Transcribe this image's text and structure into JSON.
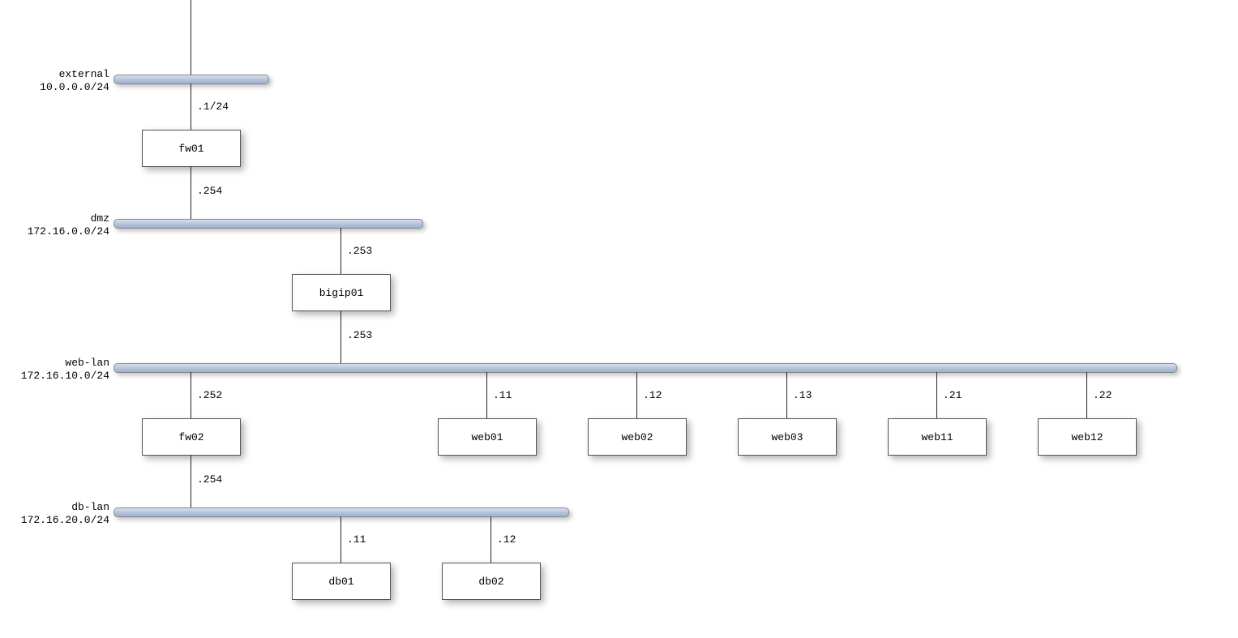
{
  "networks": {
    "external": {
      "name": "external",
      "cidr": "10.0.0.0/24"
    },
    "dmz": {
      "name": "dmz",
      "cidr": "172.16.0.0/24"
    },
    "weblan": {
      "name": "web-lan",
      "cidr": "172.16.10.0/24"
    },
    "dblan": {
      "name": "db-lan",
      "cidr": "172.16.20.0/24"
    }
  },
  "nodes": {
    "fw01": {
      "name": "fw01"
    },
    "bigip01": {
      "name": "bigip01"
    },
    "fw02": {
      "name": "fw02"
    },
    "web01": {
      "name": "web01"
    },
    "web02": {
      "name": "web02"
    },
    "web03": {
      "name": "web03"
    },
    "web11": {
      "name": "web11"
    },
    "web12": {
      "name": "web12"
    },
    "db01": {
      "name": "db01"
    },
    "db02": {
      "name": "db02"
    }
  },
  "interfaces": {
    "fw01_ext": ".1/24",
    "fw01_dmz": ".254",
    "bigip01_dmz": ".253",
    "bigip01_web": ".253",
    "fw02_web": ".252",
    "fw02_db": ".254",
    "web01": ".11",
    "web02": ".12",
    "web03": ".13",
    "web11": ".21",
    "web12": ".22",
    "db01": ".11",
    "db02": ".12"
  }
}
